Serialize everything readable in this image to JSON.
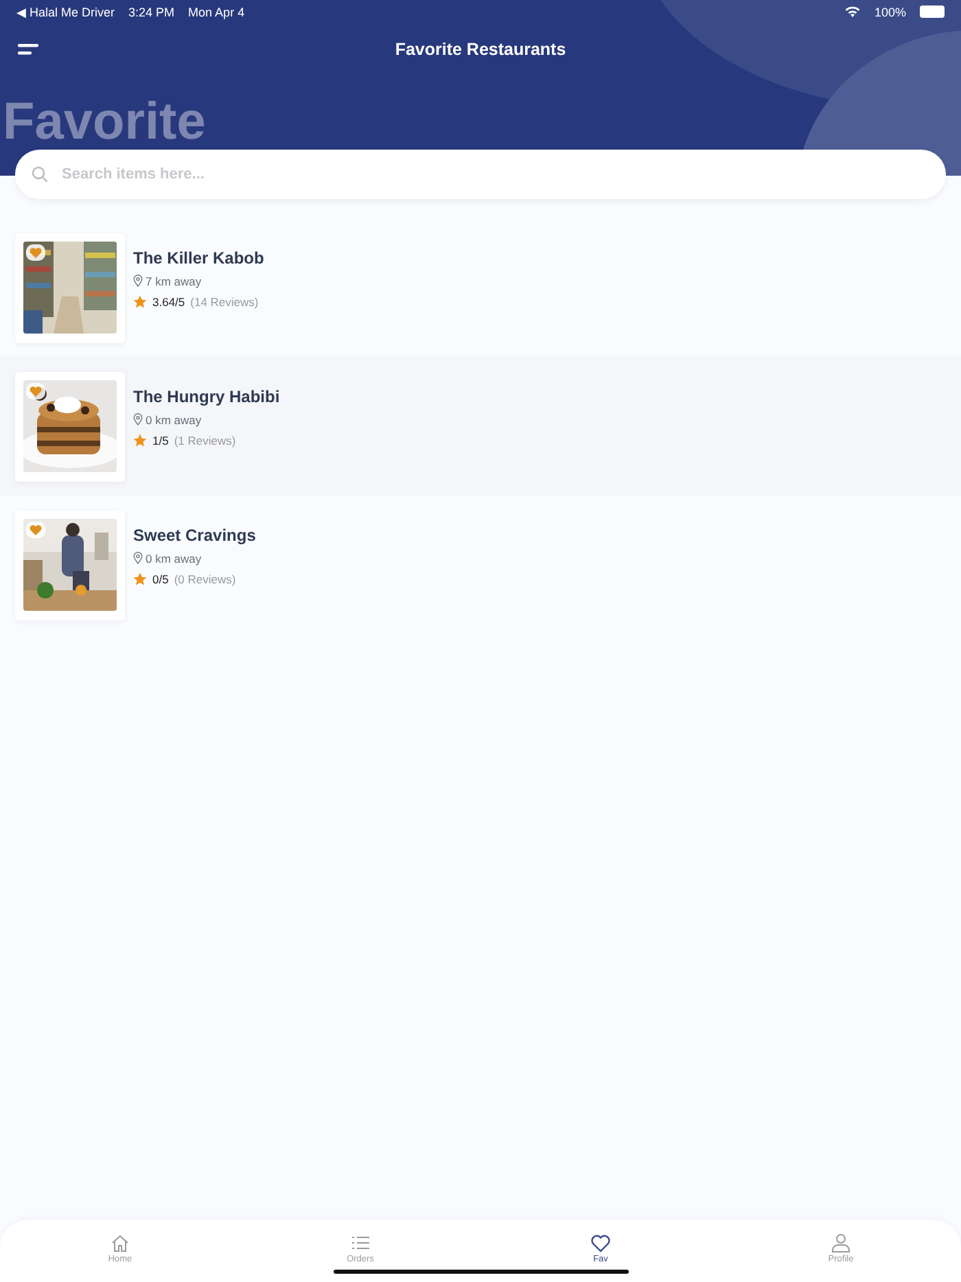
{
  "status_bar": {
    "back_app": "◀ Halal Me Driver",
    "time": "3:24 PM",
    "date": "Mon Apr 4",
    "battery": "100%"
  },
  "header": {
    "title": "Favorite Restaurants",
    "watermark": "Favorite"
  },
  "search": {
    "placeholder": "Search items here..."
  },
  "restaurants": [
    {
      "name": "The Killer Kabob",
      "distance": "7 km away",
      "rating": "3.64/5",
      "reviews": "(14 Reviews)"
    },
    {
      "name": "The Hungry Habibi",
      "distance": "0 km away",
      "rating": "1/5",
      "reviews": "(1 Reviews)"
    },
    {
      "name": "Sweet Cravings",
      "distance": "0 km away",
      "rating": "0/5",
      "reviews": "(0 Reviews)"
    }
  ],
  "tab_bar": [
    {
      "label": "Home",
      "kind": "home",
      "selected": false
    },
    {
      "label": "Orders",
      "kind": "list",
      "selected": false
    },
    {
      "label": "Fav",
      "kind": "heart",
      "selected": true
    },
    {
      "label": "Profile",
      "kind": "person",
      "selected": false
    }
  ]
}
